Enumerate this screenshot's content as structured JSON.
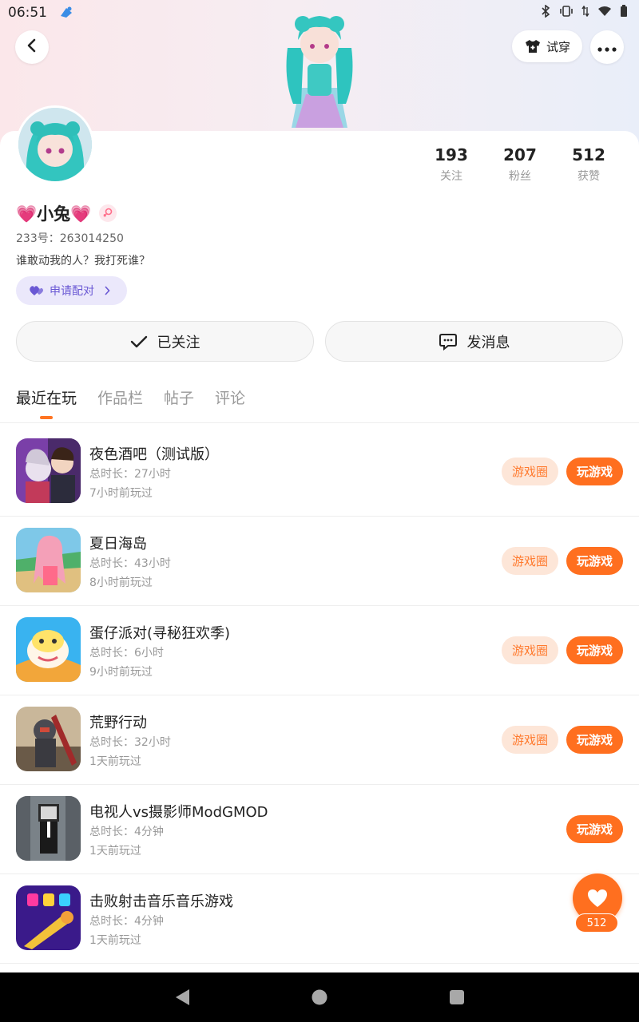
{
  "status_bar": {
    "time": "06:51"
  },
  "header": {
    "try_on_label": "试穿"
  },
  "profile": {
    "stats": [
      {
        "value": "193",
        "label": "关注"
      },
      {
        "value": "207",
        "label": "粉丝"
      },
      {
        "value": "512",
        "label": "获赞"
      }
    ],
    "name": "💗小兔💗",
    "uid": "233号：263014250",
    "bio": "谁敢动我的人？我打死谁？",
    "pair_label": "申请配对",
    "follow_label": "已关注",
    "message_label": "发消息"
  },
  "tabs": [
    "最近在玩",
    "作品栏",
    "帖子",
    "评论"
  ],
  "games": [
    {
      "title": "夜色酒吧（测试版）",
      "duration": "总时长：27小时",
      "last": "7小时前玩过",
      "circle": "游戏圈",
      "play": "玩游戏"
    },
    {
      "title": "夏日海岛",
      "duration": "总时长：43小时",
      "last": "8小时前玩过",
      "circle": "游戏圈",
      "play": "玩游戏"
    },
    {
      "title": "蛋仔派对(寻秘狂欢季)",
      "duration": "总时长：6小时",
      "last": "9小时前玩过",
      "circle": "游戏圈",
      "play": "玩游戏"
    },
    {
      "title": "荒野行动",
      "duration": "总时长：32小时",
      "last": "1天前玩过",
      "circle": "游戏圈",
      "play": "玩游戏"
    },
    {
      "title": "电视人vs摄影师ModGMOD",
      "duration": "总时长：4分钟",
      "last": "1天前玩过",
      "circle": "",
      "play": "玩游戏"
    },
    {
      "title": "击败射击音乐音乐游戏",
      "duration": "总时长：4分钟",
      "last": "1天前玩过",
      "circle": "",
      "play": ""
    }
  ],
  "like_float": {
    "count": "512"
  },
  "colors": {
    "accent": "#ff6f1f",
    "accent_light": "#fde6d8",
    "pair_bg": "#ebe8fb",
    "pair_text": "#6a58d4"
  },
  "icons": [
    "back-arrow-icon",
    "shirt-icon",
    "more-icon",
    "female-icon",
    "heart-pair-icon",
    "chevron-right-icon",
    "check-icon",
    "chat-icon",
    "heart-icon",
    "nav-back-icon",
    "nav-home-icon",
    "nav-recents-icon"
  ]
}
